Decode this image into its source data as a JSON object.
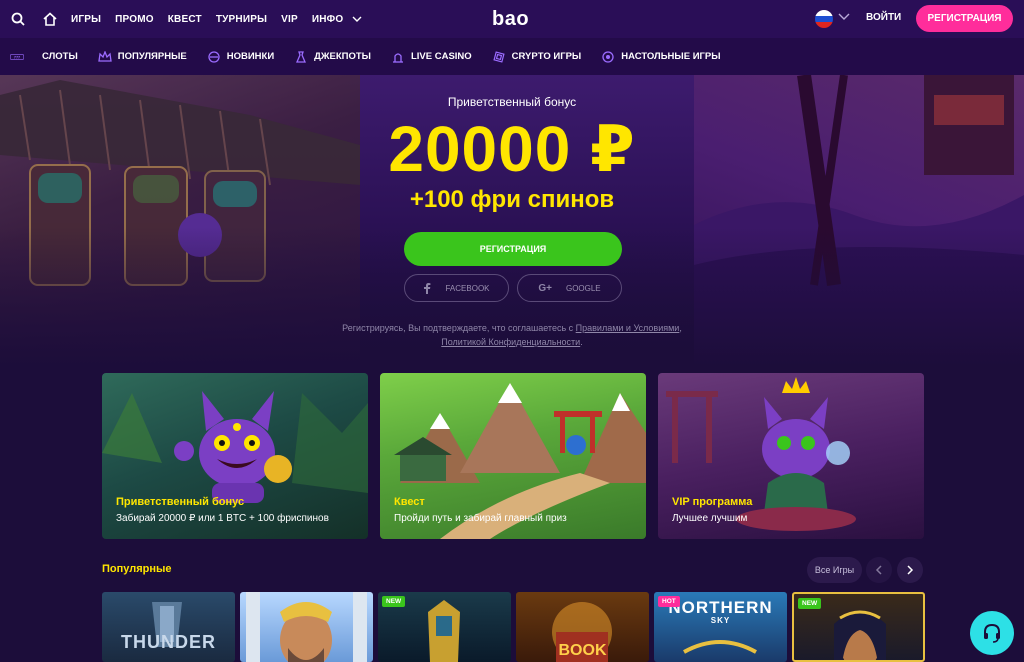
{
  "header": {
    "search_icon": "search-icon",
    "home_icon": "home-icon",
    "nav": [
      "ИГРЫ",
      "ПРОМО",
      "КВЕСТ",
      "ТУРНИРЫ",
      "VIP",
      "ИНФО"
    ],
    "logo": "bao",
    "login": "ВОЙТИ",
    "register": "РЕГИСТРАЦИЯ"
  },
  "categories": [
    {
      "label": "СЛОТЫ",
      "icon": "slots-icon"
    },
    {
      "label": "ПОПУЛЯРНЫЕ",
      "icon": "crown-icon"
    },
    {
      "label": "НОВИНКИ",
      "icon": "new-icon"
    },
    {
      "label": "ДЖЕКПОТЫ",
      "icon": "jackpot-icon"
    },
    {
      "label": "LIVE CASINO",
      "icon": "live-icon"
    },
    {
      "label": "CRYPTO ИГРЫ",
      "icon": "crypto-icon"
    },
    {
      "label": "НАСТОЛЬНЫЕ ИГРЫ",
      "icon": "table-games-icon"
    }
  ],
  "hero": {
    "subtitle": "Приветственный бонус",
    "amount": "20000 ₽",
    "spins": "+100 фри спинов",
    "register": "РЕГИСТРАЦИЯ",
    "facebook": "FACEBOOK",
    "google": "GOOGLE",
    "terms_prefix": "Регистрируясь, Вы подтверждаете, что соглашаетесь с ",
    "terms_link": "Правилами и Условиями",
    "terms_comma": ",",
    "privacy_link": "Политикой Конфиденциальности",
    "terms_end": "."
  },
  "promos": [
    {
      "title": "Приветственный бонус",
      "desc": "Забирай 20000 ₽ или 1 BTC + 100 фриспинов"
    },
    {
      "title": "Квест",
      "desc": "Пройди путь и забирай главный приз"
    },
    {
      "title": "VIP программа",
      "desc": "Лучшее лучшим"
    }
  ],
  "popular": {
    "title": "Популярные",
    "all_games": "Все Игры",
    "games": [
      {
        "name": "THUNDER",
        "badge": ""
      },
      {
        "name": "",
        "badge": ""
      },
      {
        "name": "",
        "badge": "NEW"
      },
      {
        "name": "BOOK",
        "badge": ""
      },
      {
        "name": "NORTHERN",
        "sub": "SKY",
        "badge": "HOT"
      },
      {
        "name": "",
        "badge": "NEW"
      }
    ]
  },
  "colors": {
    "accent_yellow": "#ffe600",
    "register_pink": "#ff2d9b",
    "register_green": "#3ac51c",
    "support_cyan": "#2de0e6"
  }
}
